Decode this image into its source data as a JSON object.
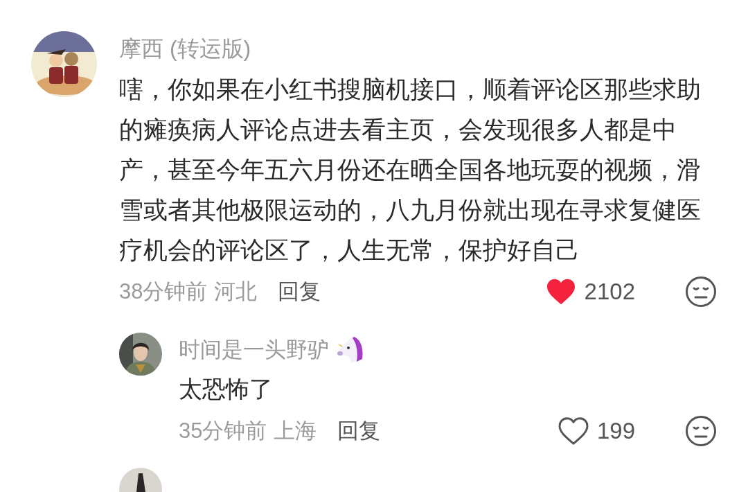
{
  "comments": [
    {
      "author": "摩西 (转运版)",
      "text": "嗐，你如果在小红书搜脑机接口，顺着评论区那些求助的瘫痪病人评论点进去看主页，会发现很多人都是中产，甚至今年五六月份还在晒全国各地玩耍的视频，滑雪或者其他极限运动的，八九月份就出现在寻求复健医疗机会的评论区了，人生无常，保护好自己",
      "time": "38分钟前",
      "location": "河北",
      "reply_label": "回复",
      "liked": true,
      "likes": "2102",
      "replies": [
        {
          "kind": "full",
          "author": "时间是一头野驴",
          "text": "太恐怖了",
          "time": "35分钟前",
          "location": "上海",
          "reply_label": "回复",
          "liked": false,
          "likes": "199"
        },
        {
          "kind": "cut_off"
        }
      ]
    }
  ]
}
